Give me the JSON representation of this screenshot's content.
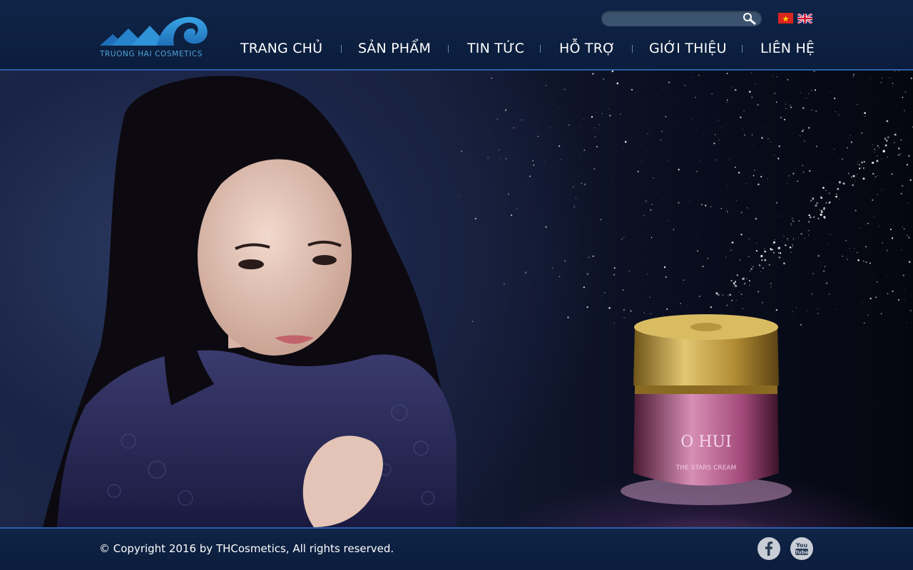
{
  "brand": {
    "name": "TRUONG HAI COSMETICS",
    "colors": {
      "header_bg": "#0f2447",
      "accent_line": "#2a5fa8",
      "logo_blue": "#4ea3d9"
    }
  },
  "search": {
    "placeholder": "",
    "value": "",
    "icon": "search-icon"
  },
  "languages": [
    {
      "code": "vi",
      "icon": "vietnam-flag-icon"
    },
    {
      "code": "en",
      "icon": "uk-flag-icon"
    }
  ],
  "nav": {
    "items": [
      {
        "label": "TRANG CHỦ"
      },
      {
        "label": "SẢN PHẨM"
      },
      {
        "label": "TIN TỨC"
      },
      {
        "label": "HỖ TRỢ"
      },
      {
        "label": "GIỚI THIỆU"
      },
      {
        "label": "LIÊN HỆ"
      }
    ]
  },
  "hero": {
    "product_brand": "O HUI",
    "product_name": "THE STARS CREAM"
  },
  "footer": {
    "copyright": "© Copyright 2016 by THCosmetics, All rights reserved.",
    "social": [
      {
        "icon": "facebook-icon"
      },
      {
        "icon": "youtube-icon",
        "text": "You\nTube"
      }
    ]
  }
}
